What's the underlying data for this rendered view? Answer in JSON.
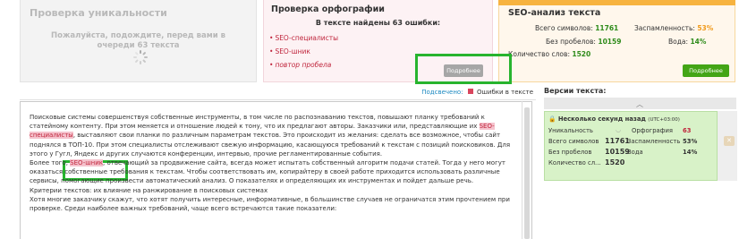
{
  "uniqueness": {
    "title": "Проверка уникальности",
    "message": "Пожалуйста, подождите, перед вами в очереди 63 текста"
  },
  "spelling": {
    "title": "Проверка орфографии",
    "found": "В тексте найдены 63 ошибки:",
    "errors": [
      "SEO-специалисты",
      "SEO-шник",
      "повтор пробела"
    ],
    "more_button": "Подробнее"
  },
  "seo": {
    "title": "SEO-анализ текста",
    "chars_label": "Всего символов:",
    "chars_value": "11761",
    "nospace_label": "Без пробелов:",
    "nospace_value": "10159",
    "words_label": "Количество слов:",
    "words_value": "1520",
    "spam_label": "Заспамленность:",
    "spam_value": "53%",
    "water_label": "Вода:",
    "water_value": "14%",
    "more_button": "Подробнее"
  },
  "editor": {
    "legend_link": "Подсвечено:",
    "legend_label": "Ошибки в тексте",
    "p1a": "Поисковые системы совершенствуя собственные инструменты, в том числе по распознаванию текстов, повышают планку требований к статейному контенту. При этом меняется и отношение людей к тону, что их предлагают авторы. Заказчики или, представляющие их ",
    "p1err": "SEO-специалисты",
    "p1b": ", выставляют свои планки по различным параметрам текстов. Это происходит из желания: сделать все возможное, чтобы сайт поднялся в ТОП-10. При этом специалисты отслеживают свежую информацию, касающуюся требований к текстам с позиций поисковиков. Для этого у Гугл, Яндекс и других случаются конференции, интервью, прочие регламентированные события.",
    "p2a": "Более того, ",
    "p2err": "SEO-шник",
    "p2b": ", отвечающий за продвижение сайта, всегда может испытать собственный алгоритм подачи статей. Тогда у него могут оказаться собственные требования к текстам. Чтобы соответствовать им, копирайтеру в своей работе приходится использовать различные сервисы, помогающие произвести автоматический анализ. О показателях и определяющих их инструментах и пойдет дальше речь.",
    "p3": "Критерии текстов: их влияние на ранжирование в поисковых системах",
    "p4": "Хотя многие заказчику скажут, что хотят получить интересные, информативные, в большинстве случаев не ограничатся этим прочтением при проверке. Среди наиболее важных требований, чаще всего встречаются такие показатели:"
  },
  "versions": {
    "title": "Версии текста:",
    "collapse_icon": "chevron-up",
    "card": {
      "header": "Несколько секунд назад",
      "tz": "(UTC+03:00)",
      "uniq_label": "Уникальность",
      "spell_label": "Орфография",
      "spell_value": "63",
      "chars_label": "Всего символов",
      "chars_value": "11761",
      "spam_label": "Заспамленность",
      "spam_value": "53%",
      "nospace_label": "Без пробелов",
      "nospace_value": "10159",
      "water_label": "Вода",
      "water_value": "14%",
      "words_label": "Количество сл...",
      "words_value": "1520"
    }
  },
  "colors": {
    "error_red": "#c0263d",
    "green": "#43a516",
    "highlight_green": "#27b42e",
    "orange": "#f7b340"
  }
}
